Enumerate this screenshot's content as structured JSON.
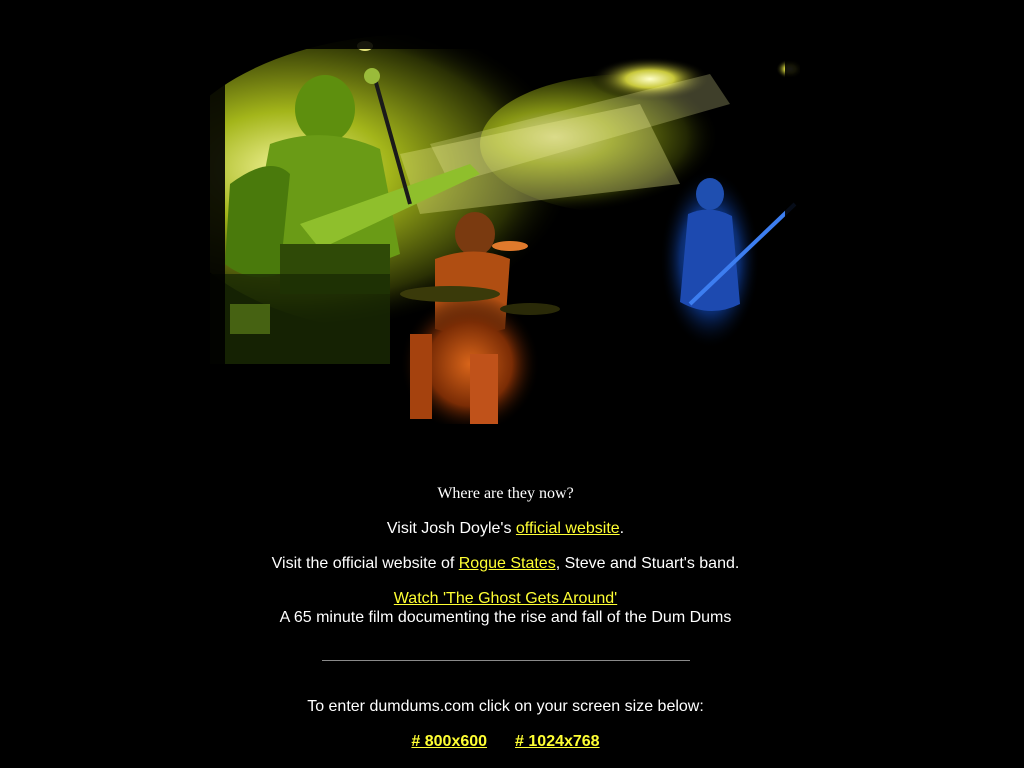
{
  "photo": {
    "alt_name": "band-live-photo"
  },
  "question": "Where are they now?",
  "josh": {
    "prefix": "Visit Josh Doyle's ",
    "link": "official website",
    "suffix": "."
  },
  "rogue": {
    "prefix": "Visit the official website of ",
    "link": "Rogue States",
    "suffix": ", Steve and Stuart's band."
  },
  "film": {
    "link": "Watch 'The Ghost Gets Around'",
    "description": "A 65 minute film documenting the rise and fall of the Dum Dums"
  },
  "enter": {
    "prompt": "To enter dumdums.com click on your screen size below:",
    "option_small": "# 800x600",
    "option_large": "# 1024x768"
  },
  "colors": {
    "background": "#000000",
    "link": "#ffff33",
    "text": "#ffffff"
  }
}
